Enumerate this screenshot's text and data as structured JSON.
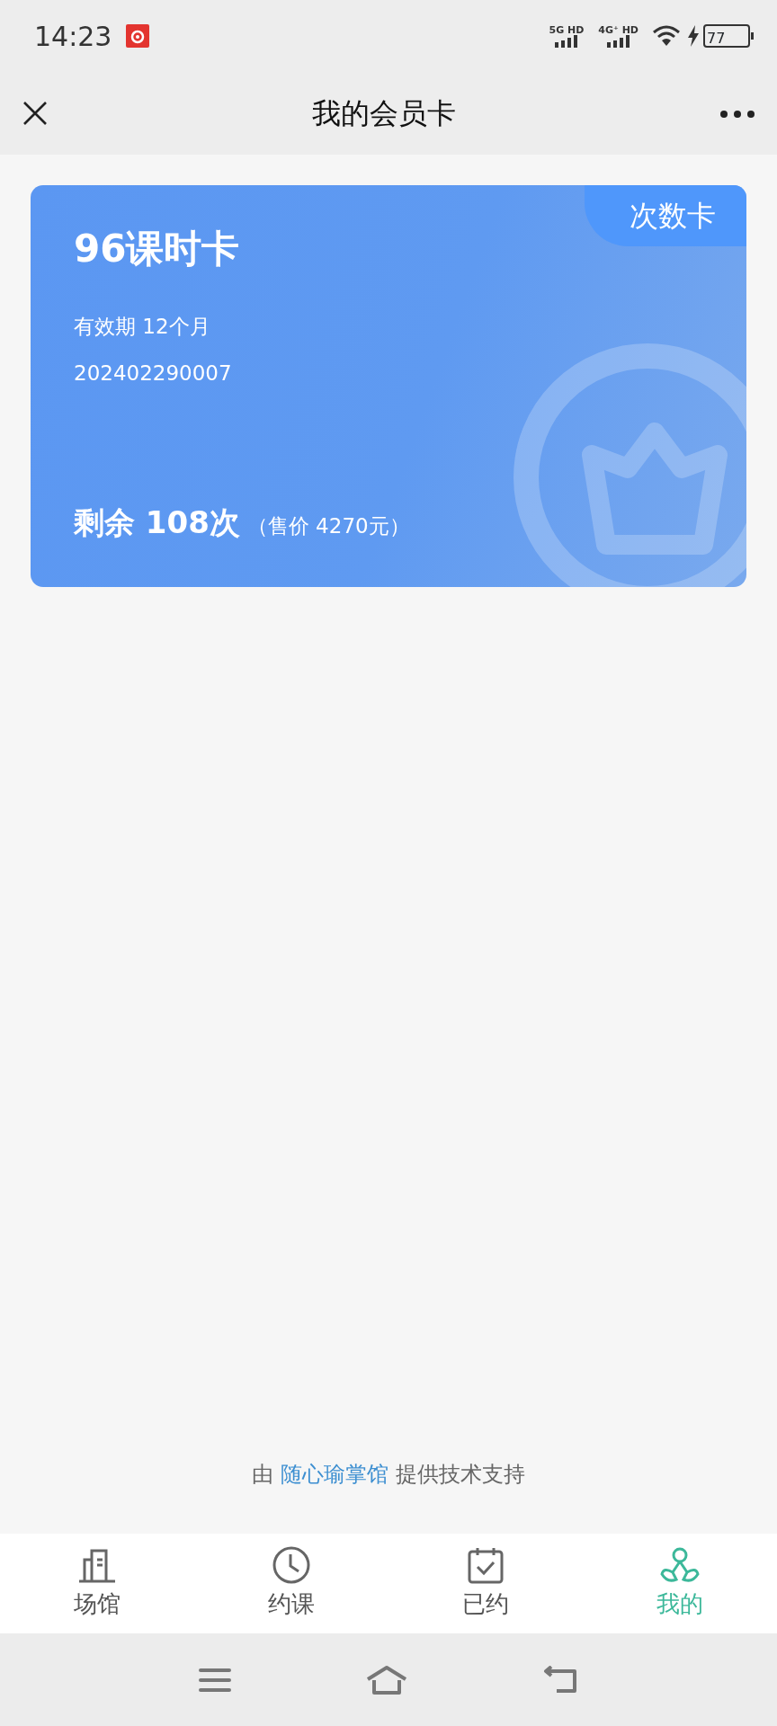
{
  "status_bar": {
    "time": "14:23",
    "network_1": "5G HD",
    "network_2": "4G⁺ HD",
    "battery": "77"
  },
  "header": {
    "title": "我的会员卡"
  },
  "card": {
    "badge": "次数卡",
    "name": "96课时卡",
    "validity": "有效期 12个月",
    "number": "202402290007",
    "remaining": "剩余 108次",
    "price": "（售价 4270元）"
  },
  "footer": {
    "prefix": "由",
    "link": "随心瑜掌馆",
    "suffix": "提供技术支持"
  },
  "tabs": [
    {
      "kind": "venue",
      "label": "场馆",
      "selected": false
    },
    {
      "kind": "book",
      "label": "约课",
      "selected": false
    },
    {
      "kind": "booked",
      "label": "已约",
      "selected": false
    },
    {
      "kind": "mine",
      "label": "我的",
      "selected": true
    }
  ]
}
